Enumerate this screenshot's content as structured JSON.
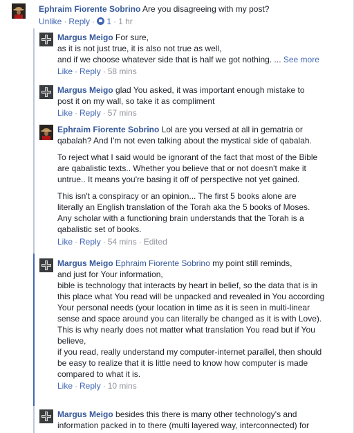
{
  "comments": [
    {
      "author": "Ephraim Fiorente Sobrino",
      "text": "Are you disagreeing with my post?",
      "actions": {
        "like": "Unlike",
        "reply": "Reply",
        "reaction_count": "1",
        "time": "1 hr"
      }
    },
    {
      "author": "Margus Meigo",
      "lines": [
        "For sure,",
        "as it is not just true, it is also not true as well,",
        "and if we choose whatever side that is half we got nothing. ..."
      ],
      "see_more": "See more",
      "actions": {
        "like": "Like",
        "reply": "Reply",
        "time": "58 mins"
      }
    },
    {
      "author": "Margus Meigo",
      "text": "glad You asked, it was important enough mistake to post it on my wall, so take it as compliment",
      "actions": {
        "like": "Like",
        "reply": "Reply",
        "time": "57 mins"
      }
    },
    {
      "author": "Ephraim Fiorente Sobrino",
      "paragraphs": [
        "Lol are you versed at all in gematria or qabalah? And I'm not even talking about the mystical side of qabalah.",
        "To reject what I said would be ignorant of the fact that most of the Bible are qabalistic texts.. Whether you believe that or not doesn't make it untrue.. It means you're basing it off of perspective not yet gained.",
        "This isn't a conspiracy or an opinion... The first 5 books alone are literally an English translation of the Torah aka the 5 books of Moses. Any scholar with a functioning brain understands that the Torah is a qabalistic set of books."
      ],
      "actions": {
        "like": "Like",
        "reply": "Reply",
        "time": "54 mins",
        "edited": "Edited"
      }
    },
    {
      "author": "Margus Meigo",
      "mention": "Ephraim Fiorente Sobrino",
      "first_text": "my point still reminds,",
      "lines": [
        "and just for Your information,",
        "bible is technology that interacts by heart in belief, so the data that is in this place what You read will be unpacked and revealed in You according Your personal needs (your location in time as it is seen in multi-linear sense and space around you can literally be changed as it is with Love).",
        "This is why nearly does not matter what translation You read but if You believe,",
        "if you read, really understand my computer-internet parallel, then should be easy to realize that it is little need to know how computer is made compared to what it is."
      ],
      "actions": {
        "like": "Like",
        "reply": "Reply",
        "time": "10 mins"
      }
    },
    {
      "author": "Margus Meigo",
      "text": "besides this there is many other technology's and information packed in to there (multi layered way, interconnected) for"
    }
  ],
  "colors": {
    "author": "#365899",
    "link": "#4267b2",
    "meta": "#90949c",
    "text": "#1d2129",
    "reply_rule": "#bdc7d8",
    "focus_rule": "#4267b2"
  }
}
